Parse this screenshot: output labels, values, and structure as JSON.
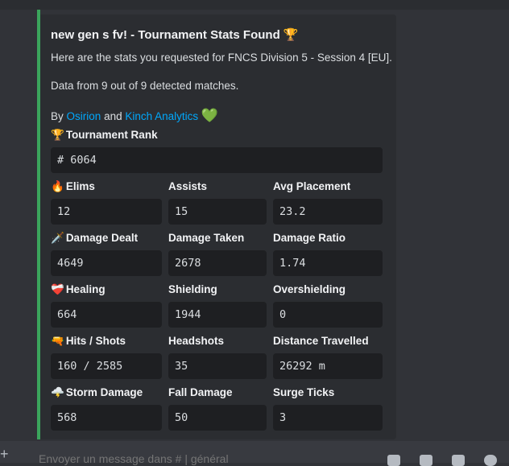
{
  "embed": {
    "title": "new gen s fv! - Tournament Stats Found",
    "title_emoji": "🏆",
    "accent_color": "#3ba55c",
    "intro": "Here are the stats you requested for FNCS Division 5 - Session 4 [EU].",
    "matches": "Data from 9 out of 9 detected matches.",
    "byline": {
      "prefix": "By",
      "author1": "Osirion",
      "and": "and",
      "author2": "Kinch Analytics",
      "heart": "💚"
    },
    "rank": {
      "emoji": "🏆",
      "name": "Tournament Rank",
      "value": "# 6064"
    },
    "rows": [
      [
        {
          "emoji": "🔥",
          "name": "Elims",
          "value": "12"
        },
        {
          "name": "Assists",
          "value": "15"
        },
        {
          "name": "Avg Placement",
          "value": "23.2"
        }
      ],
      [
        {
          "emoji": "🗡️",
          "name": "Damage Dealt",
          "value": "4649"
        },
        {
          "name": "Damage Taken",
          "value": "2678"
        },
        {
          "name": "Damage Ratio",
          "value": "1.74"
        }
      ],
      [
        {
          "emoji": "❤️‍🩹",
          "name": "Healing",
          "value": "664"
        },
        {
          "name": "Shielding",
          "value": "1944"
        },
        {
          "name": "Overshielding",
          "value": "0"
        }
      ],
      [
        {
          "emoji": "🔫",
          "name": "Hits / Shots",
          "value": "160 / 2585"
        },
        {
          "name": "Headshots",
          "value": "35"
        },
        {
          "name": "Distance Travelled",
          "value": "26292 m"
        }
      ],
      [
        {
          "emoji": "🌩️",
          "name": "Storm Damage",
          "value": "568"
        },
        {
          "name": "Fall Damage",
          "value": "50"
        },
        {
          "name": "Surge Ticks",
          "value": "3"
        }
      ]
    ]
  },
  "composer": {
    "placeholder": "Envoyer un message dans # | général"
  },
  "colors": {
    "background": "#313338",
    "embed_bg": "#2b2d31",
    "field_bg": "#1e1f22",
    "link": "#00a8fc"
  }
}
